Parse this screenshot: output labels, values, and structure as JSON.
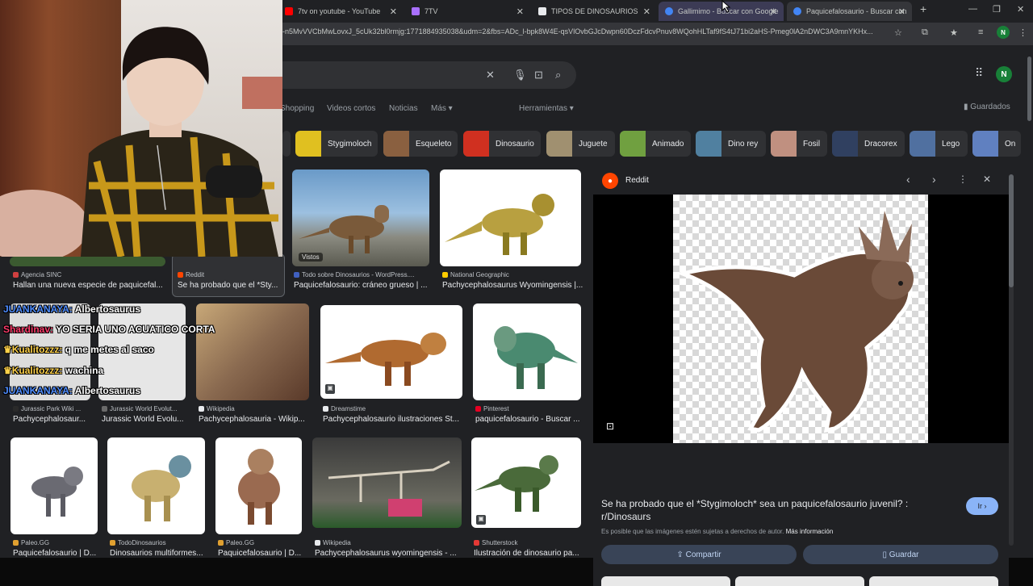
{
  "tabs": [
    {
      "title": "7tv on youtube - YouTube",
      "color": "#ff0000"
    },
    {
      "title": "7TV",
      "color": "#a970ff"
    },
    {
      "title": "TIPOS DE DINOSAURIOS",
      "color": "#e8eaed"
    },
    {
      "title": "Gallimimo - Buscar con Google",
      "color": "#4285f4"
    },
    {
      "title": "Paquicefalosaurio - Buscar con",
      "color": "#4285f4"
    }
  ],
  "address": {
    "url": "-n5MvVVCbMwLovxJ_5cUk32bl0rmjg:1771884935038&udm=2&fbs=ADc_l-bpk8W4E-qsVlOvbGJcDwpn60DczFdcvPnuv8WQohHLTaf9fS4tJ71bi2aHS-Pmeg0lA2nDWC3A9mnYKHx..."
  },
  "profile": {
    "initial": "N"
  },
  "nav": {
    "items": [
      "Shopping",
      "Videos cortos",
      "Noticias",
      "Más",
      "Herramientas"
    ],
    "saved": "Guardados"
  },
  "chips": [
    {
      "label": "Stygimoloch"
    },
    {
      "label": "Esqueleto"
    },
    {
      "label": "Dinosaurio"
    },
    {
      "label": "Juguete"
    },
    {
      "label": "Animado"
    },
    {
      "label": "Dino rey"
    },
    {
      "label": "Fosil"
    },
    {
      "label": "Dracorex"
    },
    {
      "label": "Lego"
    },
    {
      "label": "On"
    }
  ],
  "results": [
    {
      "source": "Agencia SINC",
      "title": "Hallan una nueva especie de paquicefal..."
    },
    {
      "source": "Reddit",
      "title": "Se ha probado que el *Sty..."
    },
    {
      "source": "Todo sobre Dinosaurios - WordPress....",
      "title": "Paquicefalosaurio: cráneo grueso | ..."
    },
    {
      "source": "National Geographic",
      "title": "Pachycephalosaurus Wyomingensis |..."
    },
    {
      "source": "Jurassic Park Wiki ...",
      "title": "Pachycephalosaur..."
    },
    {
      "source": "Jurassic World Evolut...",
      "title": "Jurassic World Evolu..."
    },
    {
      "source": "Wikipedia",
      "title": "Pachycephalosauria - Wikip..."
    },
    {
      "source": "Dreamstime",
      "title": "Pachycephalosaurio ilustraciones St..."
    },
    {
      "source": "Pinterest",
      "title": "paquicefalosaurio - Buscar ..."
    },
    {
      "source": "Paleo.GG",
      "title": "Paquicefalosaurio | D..."
    },
    {
      "source": "TodoDinosaurios",
      "title": "Dinosaurios multiformes..."
    },
    {
      "source": "Paleo.GG",
      "title": "Paquicefalosaurio | D..."
    },
    {
      "source": "Wikipedia",
      "title": "Pachycephalosaurus wyomingensis - ..."
    },
    {
      "source": "Shutterstock",
      "title": "Ilustración de dinosaurio pa..."
    }
  ],
  "badges": {
    "visited": "Vistos"
  },
  "panel": {
    "source": "Reddit",
    "title": "Se ha probado que el *Stygimoloch* sea un paquicefalosaurio juvenil? : r/Dinosaurs",
    "visit": "Ir",
    "notice": "Es posible que las imágenes estén sujetas a derechos de autor.",
    "more_info": "Más información",
    "share": "Compartir",
    "save": "Guardar"
  },
  "chat": [
    {
      "user": "JUANKANAYA:",
      "color": "#4f8dff",
      "msg": "Albertosaurus"
    },
    {
      "user": "Shardinav:",
      "color": "#ff3b6b",
      "msg": "YO SERIA UNO ACUATICO CORTA"
    },
    {
      "user": "Kualitozzz:",
      "color": "#ffd24a",
      "msg": "q me metes al saco"
    },
    {
      "user": "Kualitozzz:",
      "color": "#ffd24a",
      "msg": "wachina"
    },
    {
      "user": "JUANKANAYA:",
      "color": "#4f8dff",
      "msg": "Albertosaurus"
    }
  ]
}
